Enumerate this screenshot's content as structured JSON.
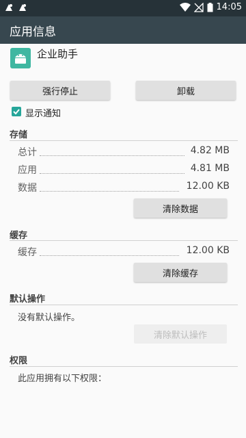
{
  "status_bar": {
    "time": "14:05",
    "icons": [
      "notification-icon",
      "notification-icon",
      "wifi-icon",
      "no-sim-icon",
      "battery-icon"
    ]
  },
  "app_bar": {
    "title": "应用信息"
  },
  "app": {
    "name": "企业助手",
    "icon": "android-icon"
  },
  "actions": {
    "force_stop": "强行停止",
    "uninstall": "卸载"
  },
  "notifications": {
    "label": "显示通知",
    "checked": true
  },
  "storage": {
    "title": "存储",
    "rows": [
      {
        "label": "总计",
        "value": "4.82 MB"
      },
      {
        "label": "应用",
        "value": "4.81 MB"
      },
      {
        "label": "数据",
        "value": "12.00 KB"
      }
    ],
    "clear_data": "清除数据"
  },
  "cache": {
    "title": "缓存",
    "row": {
      "label": "缓存",
      "value": "12.00 KB"
    },
    "clear_cache": "清除缓存"
  },
  "defaults": {
    "title": "默认操作",
    "text": "没有默认操作。",
    "clear_defaults": "清除默认操作"
  },
  "permissions": {
    "title": "权限",
    "text": "此应用拥有以下权限："
  },
  "colors": {
    "status_bar": "#263238",
    "app_bar": "#37474f",
    "accent": "#26a69a",
    "app_icon": "#3fb7a1"
  }
}
